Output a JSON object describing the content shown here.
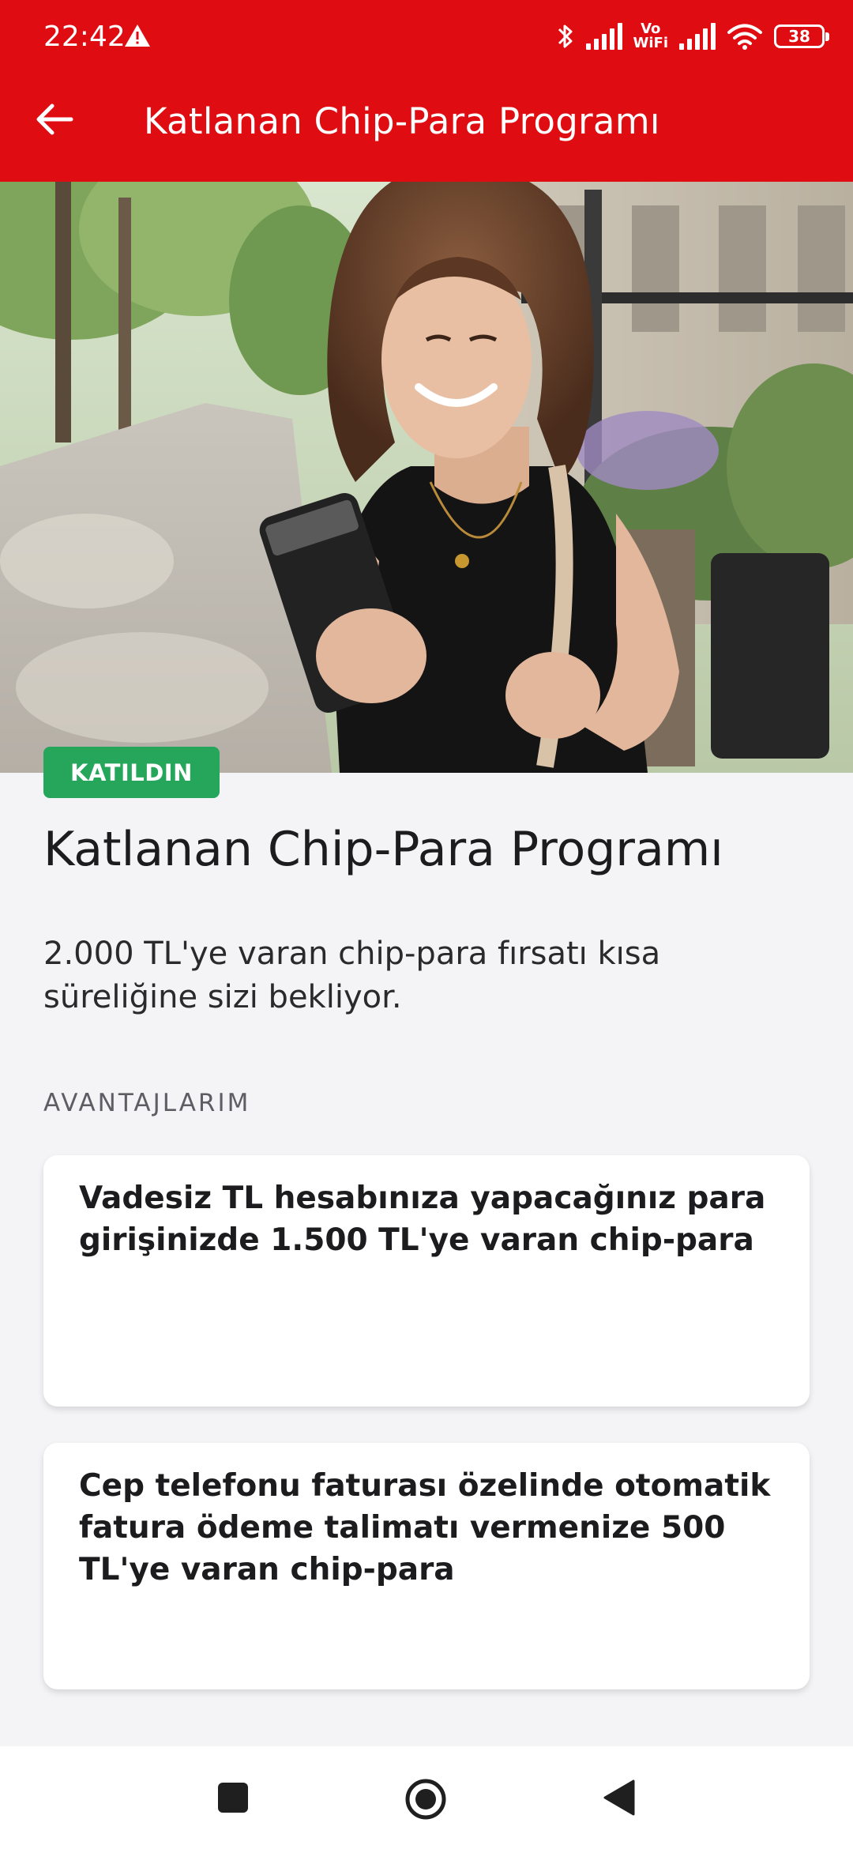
{
  "status_bar": {
    "time": "22:42",
    "vowifi_top": "Vo",
    "vowifi_bottom": "WiFi",
    "battery": "38"
  },
  "app_bar": {
    "title": "Katlanan Chip-Para Programı"
  },
  "hero": {
    "badge": "KATILDIN"
  },
  "main": {
    "title": "Katlanan Chip-Para Programı",
    "description": "2.000 TL'ye varan chip-para fırsatı kısa süreliğine sizi bekliyor.",
    "section_label": "AVANTAJLARIM",
    "cards": [
      {
        "text": "Vadesiz TL hesabınıza yapacağınız para girişinizde 1.500 TL'ye varan chip-para"
      },
      {
        "text": "Cep telefonu faturası özelinde otomatik fatura ödeme talimatı vermenize 500 TL'ye varan chip-para"
      }
    ]
  },
  "colors": {
    "brand_red": "#df0c12",
    "badge_green": "#25a65b",
    "background": "#f4f4f6"
  },
  "icons": {
    "back": "arrow-left-icon",
    "warning": "warning-icon",
    "bluetooth": "bluetooth-icon",
    "wifi": "wifi-icon",
    "nav_recent": "square-icon",
    "nav_home": "circle-icon",
    "nav_back": "triangle-icon"
  }
}
